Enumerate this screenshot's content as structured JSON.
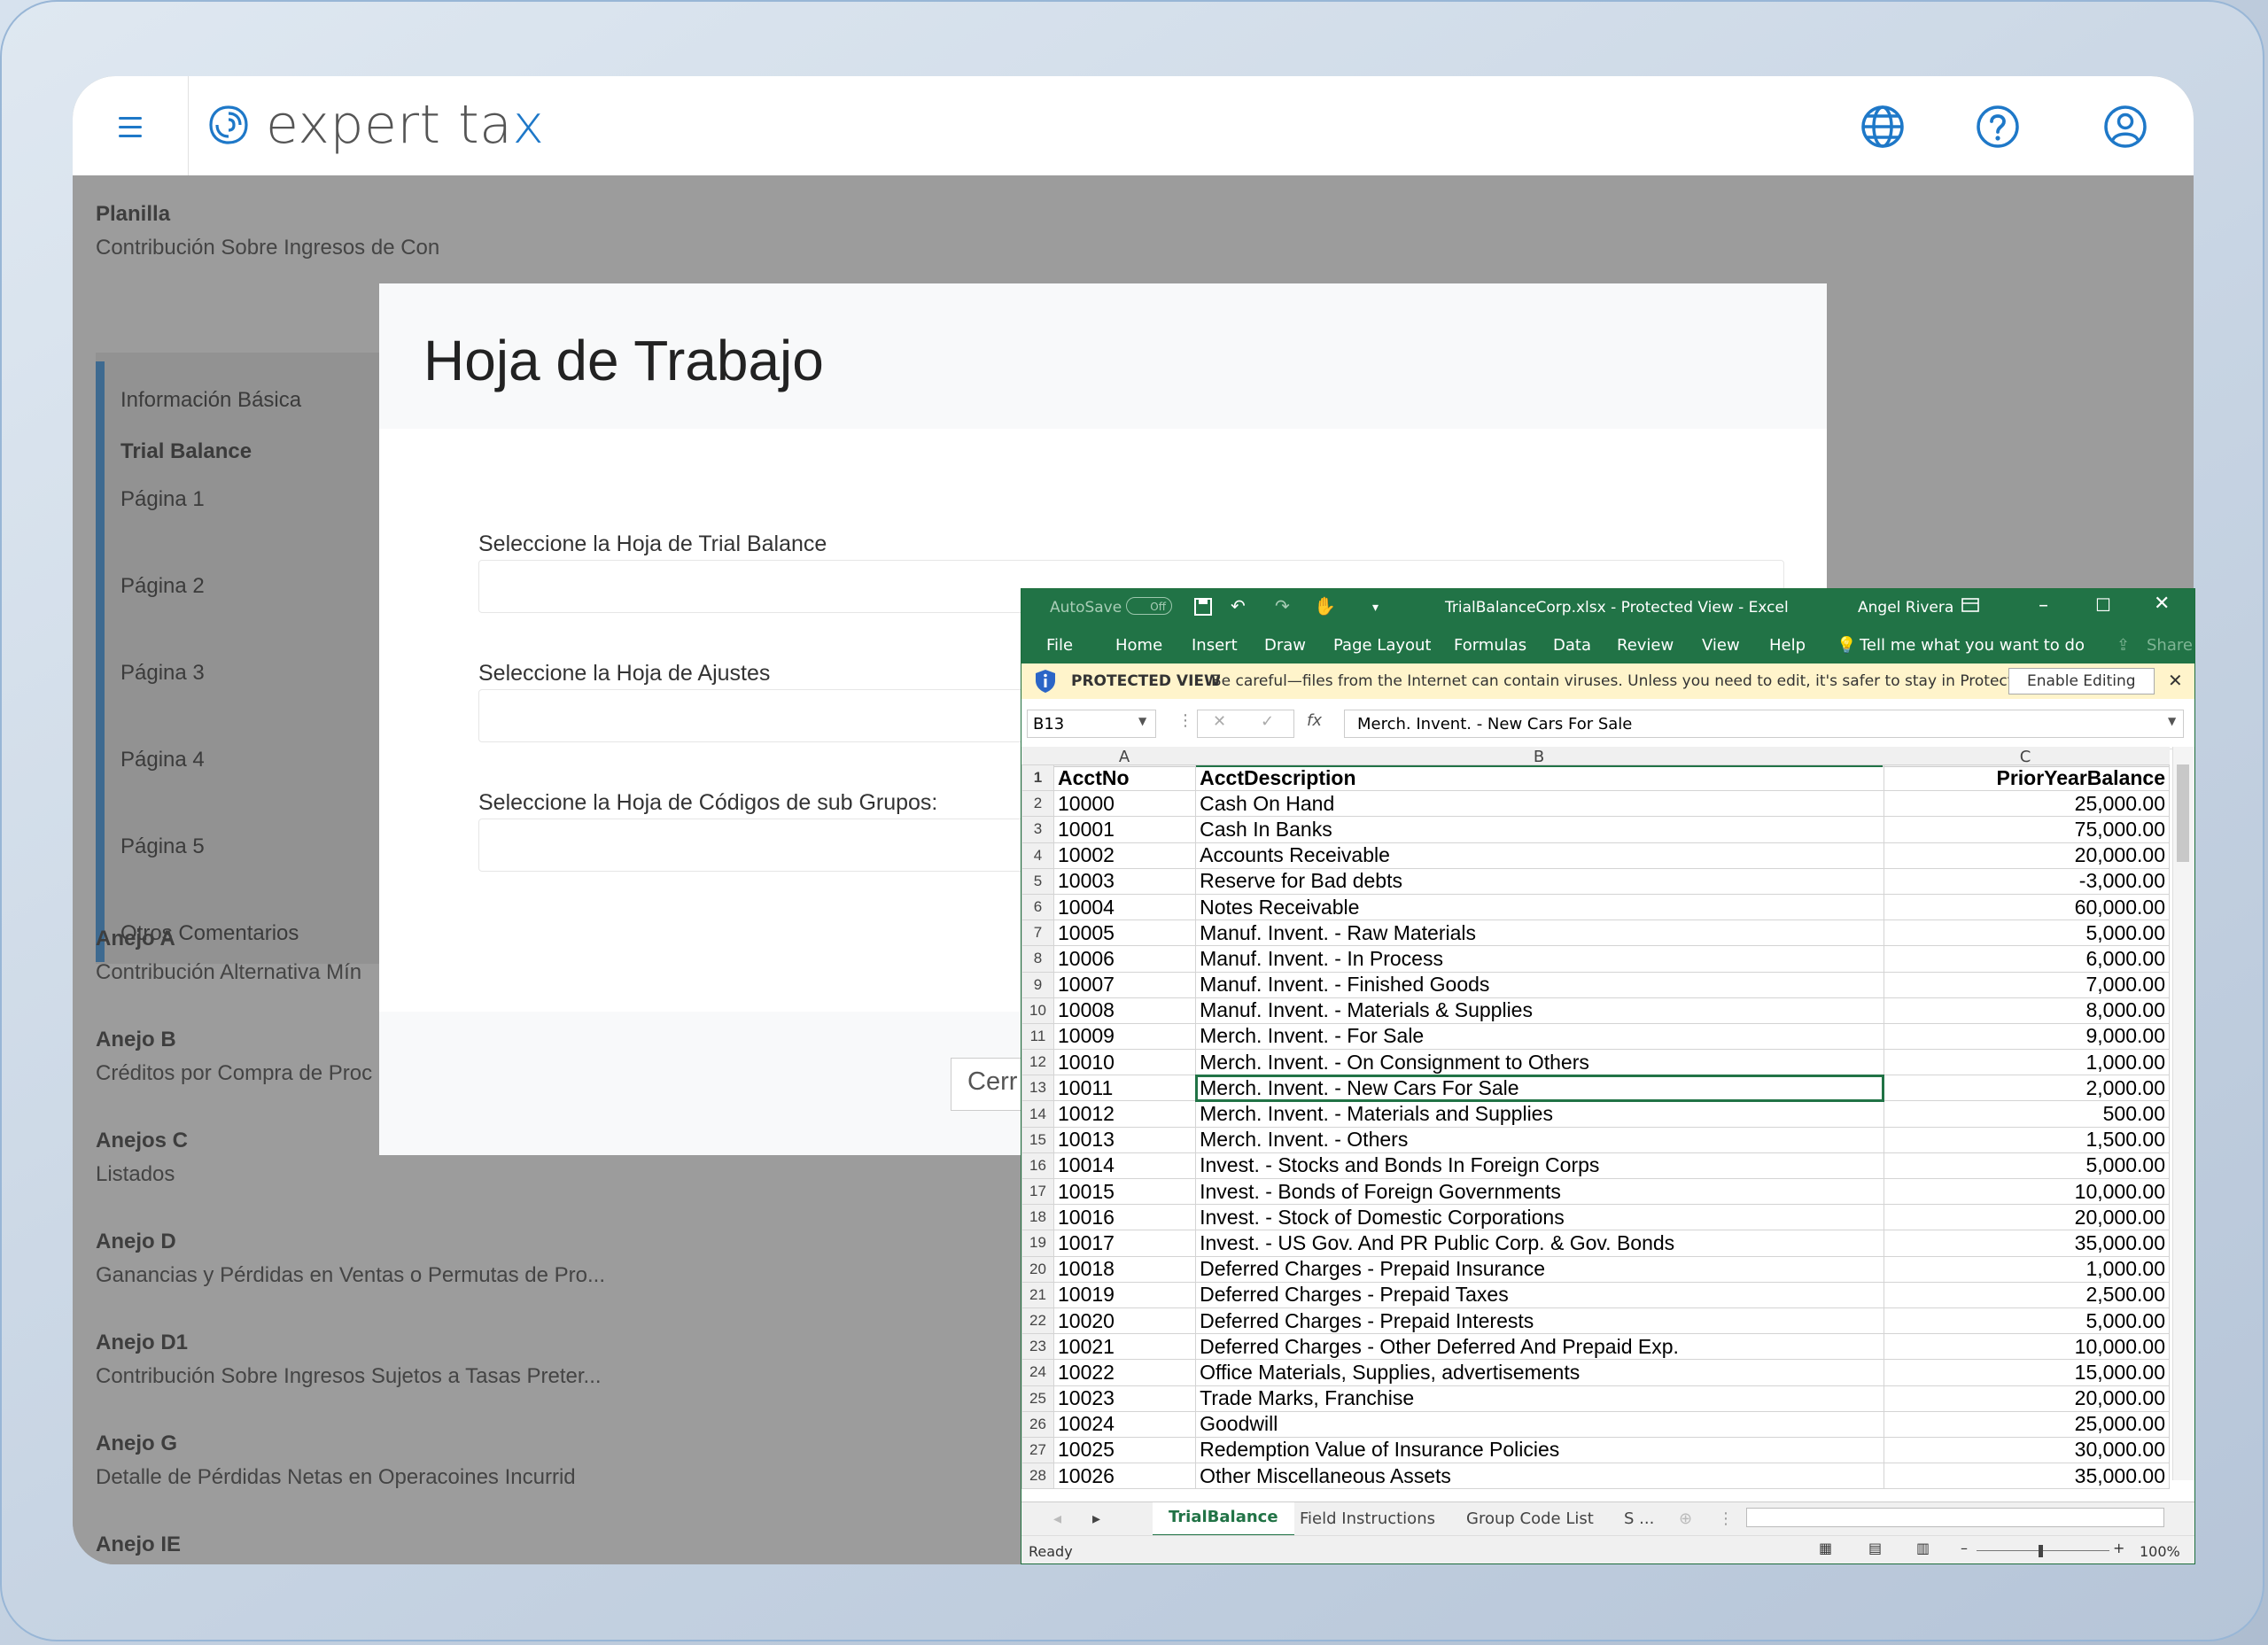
{
  "app": {
    "logo_text_1": "expert ta",
    "logo_text_2": "x"
  },
  "sidebar": {
    "planilla_title": "Planilla",
    "planilla_sub": "Contribución Sobre Ingresos de Con",
    "subnav": [
      "Información Básica",
      "Trial Balance",
      "Página 1",
      "Página 2",
      "Página 3",
      "Página 4",
      "Página 5",
      "Otros Comentarios"
    ],
    "sections": [
      {
        "title": "Anejo A",
        "sub": "Contribución Alternativa Mín"
      },
      {
        "title": "Anejo B",
        "sub": "Créditos por Compra de Proc"
      },
      {
        "title": "Anejos C",
        "sub": "Listados"
      },
      {
        "title": "Anejo D",
        "sub": "Ganancias y Pérdidas en Ventas o Permutas de Pro..."
      },
      {
        "title": "Anejo D1",
        "sub": "Contribución Sobre Ingresos Sujetos a Tasas Preter..."
      },
      {
        "title": "Anejo G",
        "sub": "Detalle de Pérdidas Netas en Operacoines Incurrid"
      },
      {
        "title": "Anejo IE",
        "sub": ""
      }
    ]
  },
  "modal": {
    "title": "Hoja de Trabajo",
    "label_trial": "Seleccione la Hoja de Trial Balance",
    "label_ajustes": "Seleccione la Hoja de Ajustes",
    "label_codigos": "Seleccione la Hoja de Códigos de sub Grupos:",
    "close_button": "Cerr"
  },
  "excel": {
    "autosave": "AutoSave",
    "autosave_state": "Off",
    "title": "TrialBalanceCorp.xlsx  -  Protected View  -  Excel",
    "user": "Angel Rivera",
    "menu": [
      "File",
      "Home",
      "Insert",
      "Draw",
      "Page Layout",
      "Formulas",
      "Data",
      "Review",
      "View",
      "Help"
    ],
    "tell_me": "Tell me what you want to do",
    "share": "Share",
    "protected_label": "PROTECTED VIEW",
    "protected_msg": "Be careful—files from the Internet can contain viruses. Unless you need to edit, it's safer to stay in Protected View.",
    "enable_editing": "Enable Editing",
    "name_box": "B13",
    "formula_value": "Merch. Invent. - New Cars For Sale",
    "col_headers": [
      "A",
      "B",
      "C"
    ],
    "rows": [
      [
        "1",
        "AcctNo",
        "AcctDescription",
        "PriorYearBalance"
      ],
      [
        "2",
        "10000",
        "Cash On Hand",
        "25,000.00"
      ],
      [
        "3",
        "10001",
        "Cash In Banks",
        "75,000.00"
      ],
      [
        "4",
        "10002",
        "Accounts Receivable",
        "20,000.00"
      ],
      [
        "5",
        "10003",
        "Reserve for Bad debts",
        "-3,000.00"
      ],
      [
        "6",
        "10004",
        "Notes Receivable",
        "60,000.00"
      ],
      [
        "7",
        "10005",
        "Manuf. Invent. - Raw Materials",
        "5,000.00"
      ],
      [
        "8",
        "10006",
        "Manuf. Invent. - In Process",
        "6,000.00"
      ],
      [
        "9",
        "10007",
        "Manuf. Invent. - Finished Goods",
        "7,000.00"
      ],
      [
        "10",
        "10008",
        "Manuf. Invent. - Materials & Supplies",
        "8,000.00"
      ],
      [
        "11",
        "10009",
        "Merch. Invent. - For Sale",
        "9,000.00"
      ],
      [
        "12",
        "10010",
        "Merch. Invent. - On Consignment to Others",
        "1,000.00"
      ],
      [
        "13",
        "10011",
        "Merch. Invent. - New Cars For Sale",
        "2,000.00"
      ],
      [
        "14",
        "10012",
        "Merch. Invent. - Materials and Supplies",
        "500.00"
      ],
      [
        "15",
        "10013",
        "Merch. Invent. - Others",
        "1,500.00"
      ],
      [
        "16",
        "10014",
        "Invest. - Stocks and Bonds In Foreign Corps",
        "5,000.00"
      ],
      [
        "17",
        "10015",
        "Invest. - Bonds of Foreign Governments",
        "10,000.00"
      ],
      [
        "18",
        "10016",
        "Invest. - Stock of Domestic Corporations",
        "20,000.00"
      ],
      [
        "19",
        "10017",
        "Invest. - US Gov. And PR Public Corp. & Gov. Bonds",
        "35,000.00"
      ],
      [
        "20",
        "10018",
        "Deferred Charges - Prepaid Insurance",
        "1,000.00"
      ],
      [
        "21",
        "10019",
        "Deferred Charges - Prepaid Taxes",
        "2,500.00"
      ],
      [
        "22",
        "10020",
        "Deferred Charges - Prepaid Interests",
        "5,000.00"
      ],
      [
        "23",
        "10021",
        "Deferred Charges - Other Deferred And Prepaid Exp.",
        "10,000.00"
      ],
      [
        "24",
        "10022",
        "Office Materials, Supplies, advertisements",
        "15,000.00"
      ],
      [
        "25",
        "10023",
        "Trade Marks, Franchise",
        "20,000.00"
      ],
      [
        "26",
        "10024",
        "Goodwill",
        "25,000.00"
      ],
      [
        "27",
        "10025",
        "Redemption Value of Insurance Policies",
        "30,000.00"
      ],
      [
        "28",
        "10026",
        "Other Miscellaneous Assets",
        "35,000.00"
      ]
    ],
    "sheet_tabs": [
      "TrialBalance",
      "Field Instructions",
      "Group Code List",
      "S ..."
    ],
    "status_ready": "Ready",
    "zoom": "100%"
  }
}
